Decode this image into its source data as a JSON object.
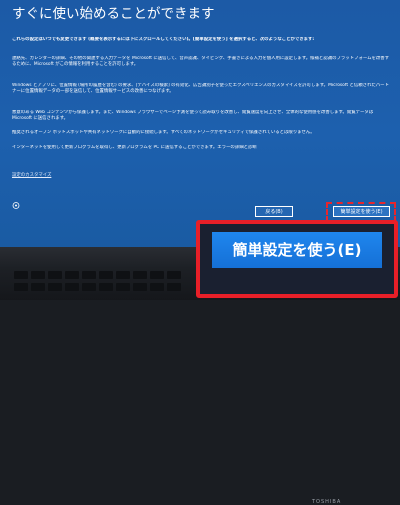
{
  "screen": {
    "title": "すぐに使い始めることができます",
    "intro": "これらの設定はいつでも変更できます (概要を表示するには下にスクロールしてください)。[簡単設定を使う] を選択すると、次のようなことができます:",
    "paragraphs": [
      "連絡先、カレンダーの詳細、その他の関連する入力データを Microsoft に送信して、音声認識、タイピング、手書きによる入力を個人用に設定します。候補と認識のプラットフォームを改善するために、Microsoft がこの情報を利用することを許可します。",
      "Windows とアプリに、位置情報 (場所の履歴を含む) の要求、[デバイスの検索] の有効化、広告識別子を使ったエクスペリエンスのカスタマイズを許可します。Microsoft と信頼されたパートナーに位置情報データの一部を送信して、位置情報サービスの改善につなげます。",
      "悪意のある Web コンテンツから保護します。また、Windows ブラウザーでページ予測を使って読み取りを改善し、閲覧速度を向上させ、全体的な使用感を改善します。閲覧データは Microsoft に送信されます。",
      "推奨されるオープン ホットスポットや共有ネットワークに自動的に接続します。すべてのネットワークがセキュリティで保護されているとは限りません。",
      "インターネットを使用して更新プログラムを取得し、更新プログラムを PC に送信することができます。エラーの詳細と診断"
    ],
    "privacy_link": "設定のカスタマイズ",
    "buttons": {
      "back": "戻る(B)",
      "express": "簡単設定を使う(E)"
    }
  },
  "zoom": {
    "label": "簡単設定を使う(E)"
  },
  "bezel": {
    "brand": "TOSHIBA"
  },
  "colors": {
    "screen_bg": "#1d60ae",
    "highlight": "#e81f28",
    "zoom_button": "#1f86ee"
  }
}
